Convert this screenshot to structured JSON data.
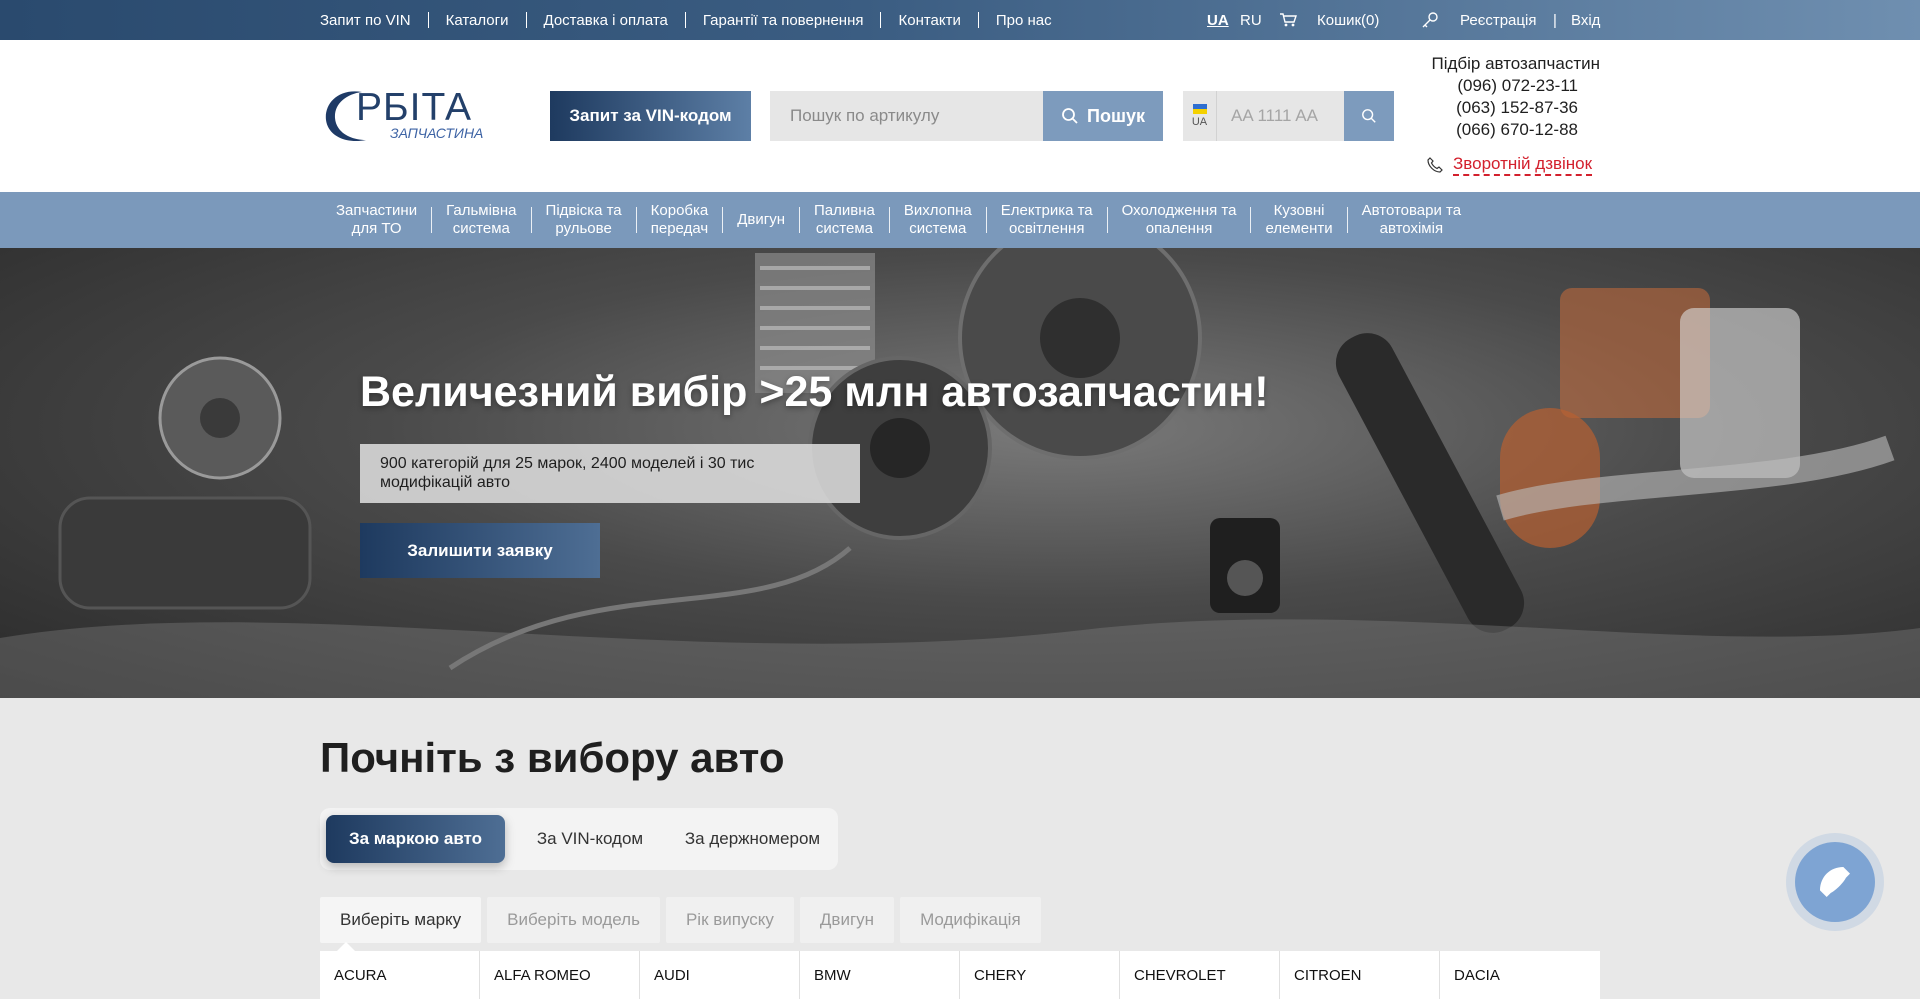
{
  "topbar": {
    "links": [
      "Запит по VIN",
      "Каталоги",
      "Доставка і оплата",
      "Гарантії та повернення",
      "Контакти",
      "Про нас"
    ],
    "lang_ua": "UA",
    "lang_ru": "RU",
    "cart": "Кошик(0)",
    "register": "Реєстрація",
    "login": "Вхід"
  },
  "header": {
    "logo_word": "РБІТА",
    "logo_sub": "ЗАПЧАСТИНА",
    "vin_button": "Запит за VIN-кодом",
    "search_placeholder": "Пошук по артикулу",
    "search_button": "Пошук",
    "plate_country": "UA",
    "plate_placeholder": "AA 1111 AA",
    "contacts_title": "Підбір автозапчастин",
    "phones": [
      "(096) 072-23-11",
      "(063) 152-87-36",
      "(066) 670-12-88"
    ],
    "callback": "Зворотній дзвінок"
  },
  "nav": [
    "Запчастини\nдля ТО",
    "Гальмівна\nсистема",
    "Підвіска та\nрульове",
    "Коробка\nпередач",
    "Двигун",
    "Паливна\nсистема",
    "Вихлопна\nсистема",
    "Електрика та\nосвітлення",
    "Охолодження та\nопалення",
    "Кузовні\nелементи",
    "Автотовари та\nавтохімія"
  ],
  "hero": {
    "title": "Величезний вибір >25 млн автозапчастин!",
    "subtitle": "900 категорій для 25 марок, 2400 моделей і 30 тис модифікацій авто",
    "cta": "Залишити заявку"
  },
  "selector": {
    "title": "Почніть з вибору авто",
    "tabs": [
      "За маркою авто",
      "За VIN-кодом",
      "За держномером"
    ],
    "steps": [
      "Виберіть марку",
      "Виберіть модель",
      "Рік випуску",
      "Двигун",
      "Модифікація"
    ],
    "brands": [
      "ACURA",
      "ALFA ROMEO",
      "AUDI",
      "BMW",
      "CHERY",
      "CHEVROLET",
      "CITROEN",
      "DACIA"
    ]
  },
  "colors": {
    "accent": "#1e3a5f",
    "nav": "#7b99bb",
    "callback_red": "#d3202d"
  }
}
